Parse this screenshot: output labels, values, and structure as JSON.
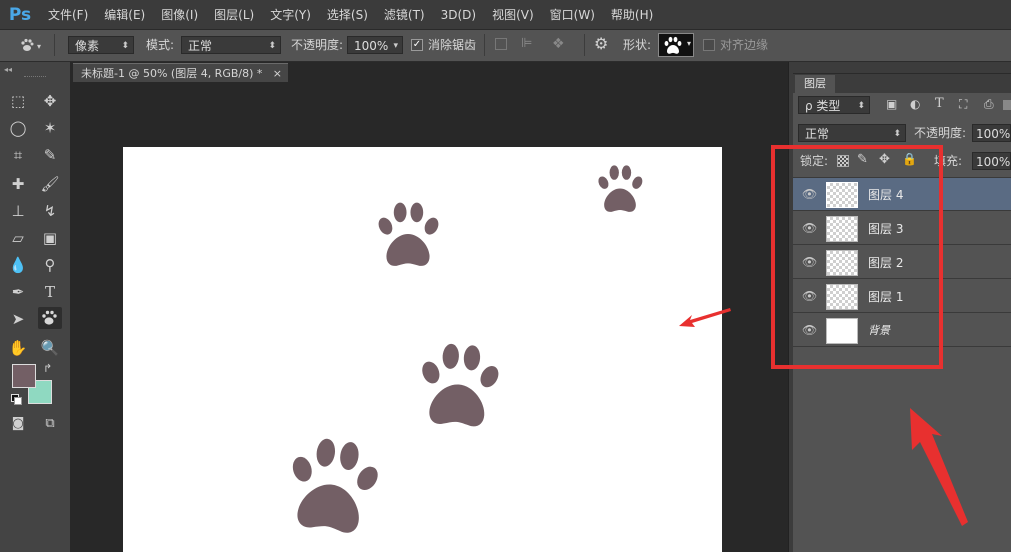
{
  "app": {
    "logo": "Ps"
  },
  "menu": [
    "文件(F)",
    "编辑(E)",
    "图像(I)",
    "图层(L)",
    "文字(Y)",
    "选择(S)",
    "滤镜(T)",
    "3D(D)",
    "视图(V)",
    "窗口(W)",
    "帮助(H)"
  ],
  "options": {
    "fill_type": "像素",
    "mode_label": "模式:",
    "mode_value": "正常",
    "opacity_label": "不透明度:",
    "opacity_value": "100%",
    "antialias_label": "消除锯齿",
    "antialias_checked": true,
    "shape_label": "形状:",
    "align_edges_label": "对齐边缘"
  },
  "document": {
    "tab_title": "未标题-1 @ 50% (图层 4, RGB/8) *",
    "close": "×"
  },
  "colors": {
    "foreground": "#735f65",
    "background": "#8fd9c1",
    "paw": "#735f65",
    "highlight": "#e8302f"
  },
  "layers_panel": {
    "tab": "图层",
    "filter_label": "ρ 类型",
    "blend_mode": "正常",
    "opacity_label": "不透明度:",
    "opacity_value": "100%",
    "lock_label": "锁定:",
    "fill_label": "填充:",
    "fill_value": "100%",
    "layers": [
      {
        "name": "图层 4",
        "selected": true,
        "visible": true,
        "thumb": "transparent"
      },
      {
        "name": "图层 3",
        "selected": false,
        "visible": true,
        "thumb": "transparent"
      },
      {
        "name": "图层 2",
        "selected": false,
        "visible": true,
        "thumb": "transparent"
      },
      {
        "name": "图层 1",
        "selected": false,
        "visible": true,
        "thumb": "transparent"
      },
      {
        "name": "背景",
        "selected": false,
        "visible": true,
        "thumb": "white"
      }
    ]
  }
}
